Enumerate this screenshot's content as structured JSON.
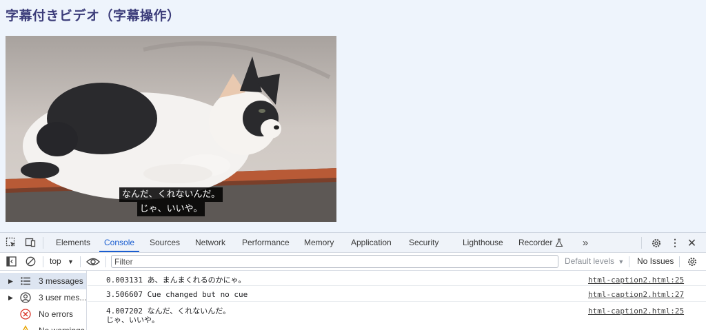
{
  "page": {
    "title": "字幕付きビデオ（字幕操作）"
  },
  "video": {
    "caption_lines": [
      "なんだ、くれないんだ。",
      "じゃ、いいや。"
    ]
  },
  "devtools": {
    "tabs": [
      "Elements",
      "Console",
      "Sources",
      "Network",
      "Performance",
      "Memory",
      "Application",
      "Security",
      "Lighthouse",
      "Recorder"
    ],
    "active_tab": "Console",
    "toolbar": {
      "context": "top",
      "filter_placeholder": "Filter",
      "levels": "Default levels",
      "issues": "No Issues"
    },
    "sidebar": [
      {
        "label": "3 messages",
        "icon": "list-icon"
      },
      {
        "label": "3 user mes...",
        "icon": "user-icon"
      },
      {
        "label": "No errors",
        "icon": "error-icon"
      },
      {
        "label": "No warnings",
        "icon": "warning-icon"
      }
    ],
    "messages": [
      {
        "text": "0.003131 あ、まんまくれるのかにゃ。",
        "source": "html-caption2.html:25"
      },
      {
        "text": "3.506607 Cue changed but no cue",
        "source": "html-caption2.html:27"
      },
      {
        "text": "4.007202 なんだ、くれないんだ。\nじゃ、いいや。",
        "source": "html-caption2.html:25"
      }
    ]
  },
  "colors": {
    "accent": "#1a5ed0",
    "title": "#3c3d7a",
    "page_bg": "#eef4fc",
    "error": "#d93025",
    "warning": "#e8a400"
  }
}
